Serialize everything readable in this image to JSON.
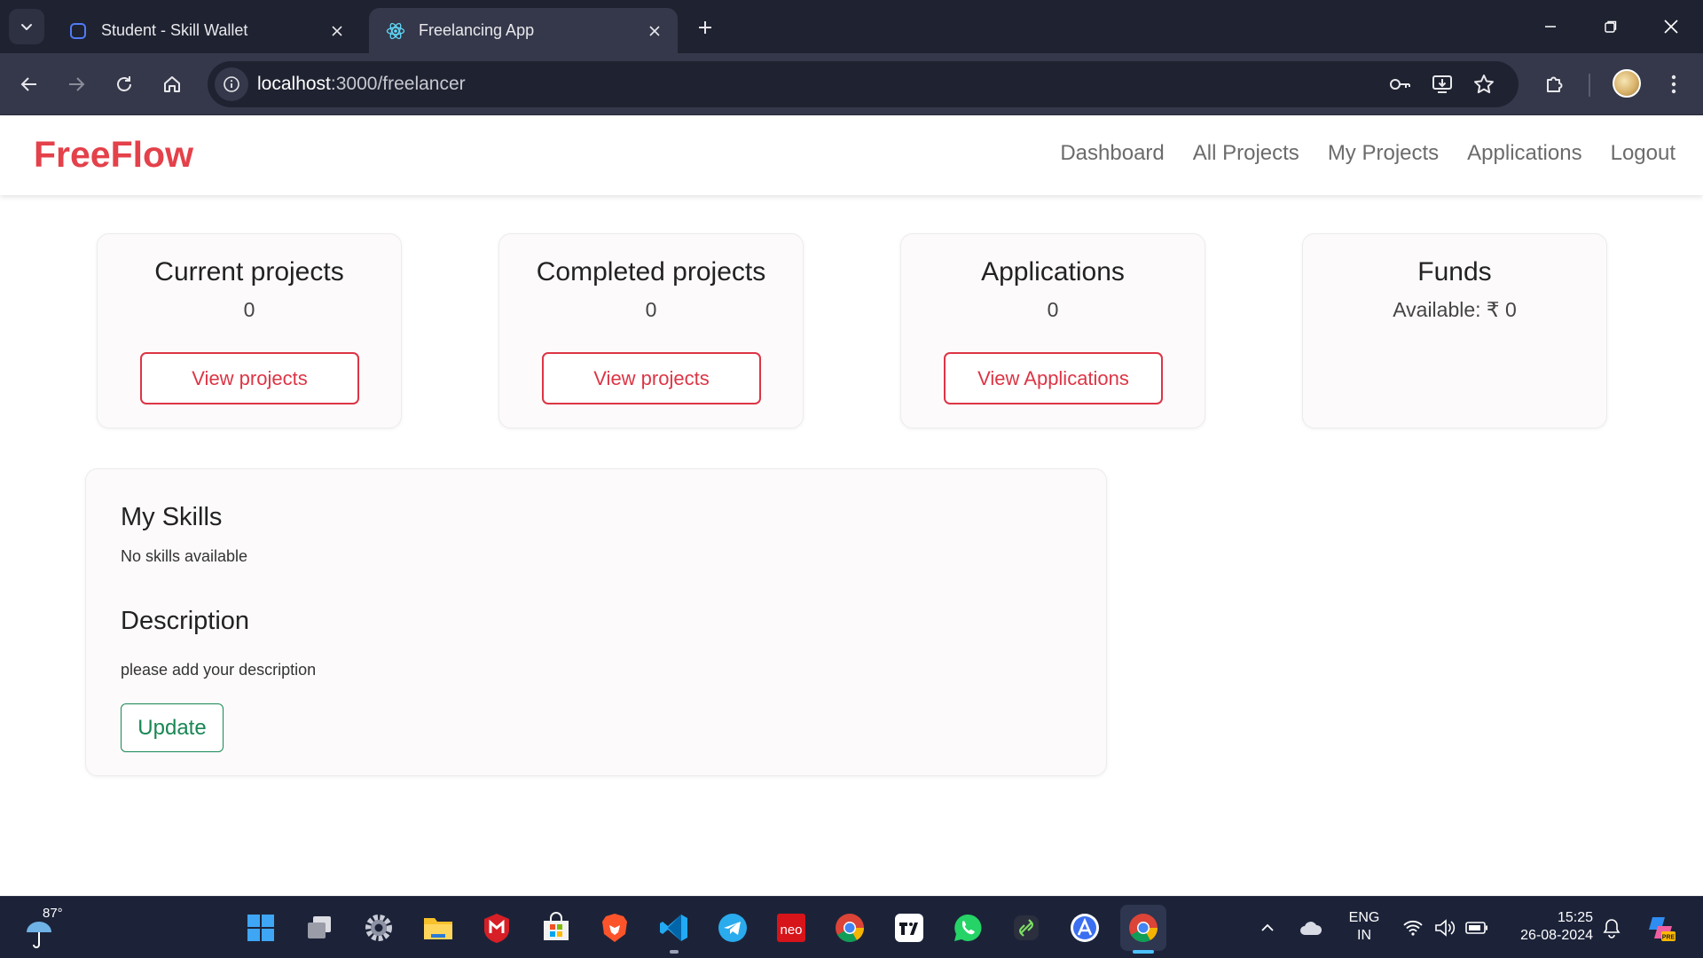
{
  "browser": {
    "tabs": [
      {
        "title": "Student - Skill Wallet",
        "active": false
      },
      {
        "title": "Freelancing App",
        "active": true
      }
    ],
    "url_host": "localhost",
    "url_path": ":3000/freelancer"
  },
  "navbar": {
    "brand": "FreeFlow",
    "links": [
      "Dashboard",
      "All Projects",
      "My Projects",
      "Applications",
      "Logout"
    ]
  },
  "cards": [
    {
      "title": "Current projects",
      "value": "0",
      "button": "View projects"
    },
    {
      "title": "Completed projects",
      "value": "0",
      "button": "View projects"
    },
    {
      "title": "Applications",
      "value": "0",
      "button": "View Applications"
    },
    {
      "title": "Funds",
      "value": "Available: ₹ 0",
      "button": ""
    }
  ],
  "profile": {
    "skills_heading": "My Skills",
    "skills_text": "No skills available",
    "description_heading": "Description",
    "description_text": "please add your description",
    "update_label": "Update"
  },
  "taskbar": {
    "weather_temp": "87°",
    "lang_line1": "ENG",
    "lang_line2": "IN",
    "time": "15:25",
    "date": "26-08-2024",
    "apps": [
      "start",
      "task-view",
      "settings",
      "file-explorer",
      "mcafee",
      "microsoft-store",
      "brave",
      "vscode",
      "telegram",
      "neo",
      "chrome",
      "tradingview",
      "whatsapp",
      "app-link",
      "app-a",
      "chrome"
    ]
  },
  "colors": {
    "brand": "#e4414a",
    "danger": "#dc3545",
    "success": "#198754",
    "chrome_dark": "#1f2230",
    "chrome_mid": "#35384a",
    "taskbar": "#1c2339"
  }
}
